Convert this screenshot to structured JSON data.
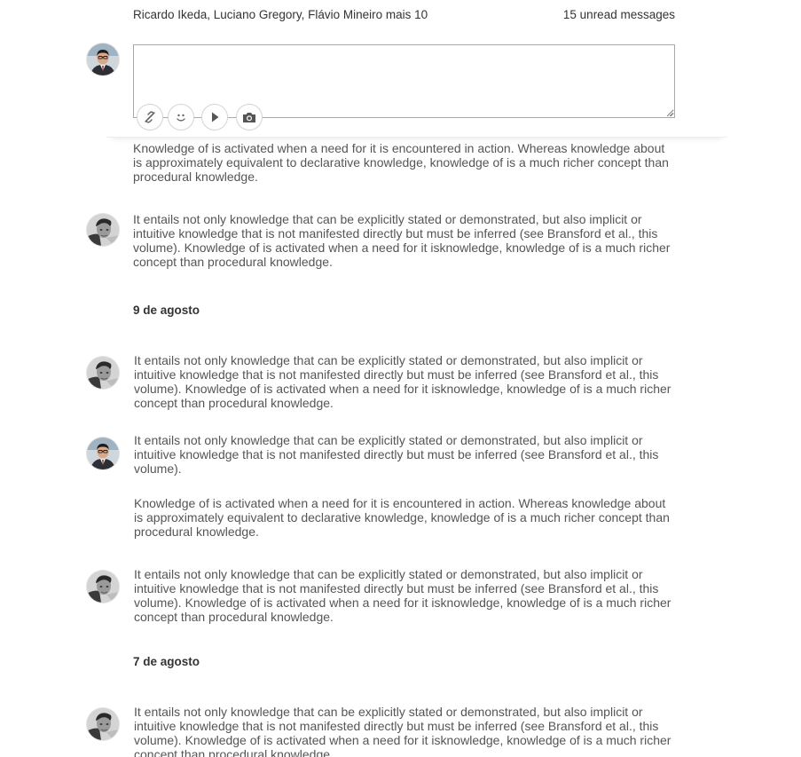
{
  "header": {
    "participants": "Ricardo Ikeda, Luciano Gregory, Flávio Mineiro mais 10",
    "unread": "15 unread messages"
  },
  "composer": {
    "placeholder": "",
    "tools": [
      "link-icon",
      "emoji-icon",
      "play-icon",
      "camera-icon"
    ]
  },
  "messages": {
    "m1": "Knowledge of is activated when a need for it is encountered in action. Whereas knowledge about is approximately equivalent to declarative knowledge, knowledge of is a much richer concept than procedural knowledge.",
    "m2": "It entails not only knowledge that can be explicitly stated or demonstrated, but also implicit or intuitive knowledge that is not manifested directly but must be inferred (see Bransford et al., this volume). Knowledge of is activated when a need for it isknowledge, knowledge of is a much richer concept than procedural knowledge.",
    "date1": "9 de agosto",
    "m3": "It entails not only knowledge that can be explicitly stated or demonstrated, but also implicit or intuitive knowledge that is not manifested directly but must be inferred (see Bransford et al., this volume). Knowledge of is activated when a need for it isknowledge, knowledge of is a much richer concept than procedural knowledge.",
    "m4": "It entails not only knowledge that can be explicitly stated or demonstrated, but also implicit or intuitive knowledge that is not manifested directly but must be inferred (see Bransford et al., this volume).",
    "m5": "Knowledge of is activated when a need for it is encountered in action. Whereas knowledge about is approximately equivalent to declarative knowledge, knowledge of is a much richer concept than procedural knowledge.",
    "m6": "It entails not only knowledge that can be explicitly stated or demonstrated, but also implicit or intuitive knowledge that is not manifested directly but must be inferred (see Bransford et al., this volume). Knowledge of is activated when a need for it isknowledge, knowledge of is a much richer concept than procedural knowledge.",
    "date2": "7 de agosto",
    "m7": "It entails not only knowledge that can be explicitly stated or demonstrated, but also implicit or intuitive knowledge that is not manifested directly but must be inferred (see Bransford et al., this volume). Knowledge of is activated when a need for it isknowledge, knowledge of is a much richer concept than procedural knowledge."
  },
  "colors": {
    "text": "#555555",
    "heading": "#333333",
    "border": "#a9a9a9"
  }
}
